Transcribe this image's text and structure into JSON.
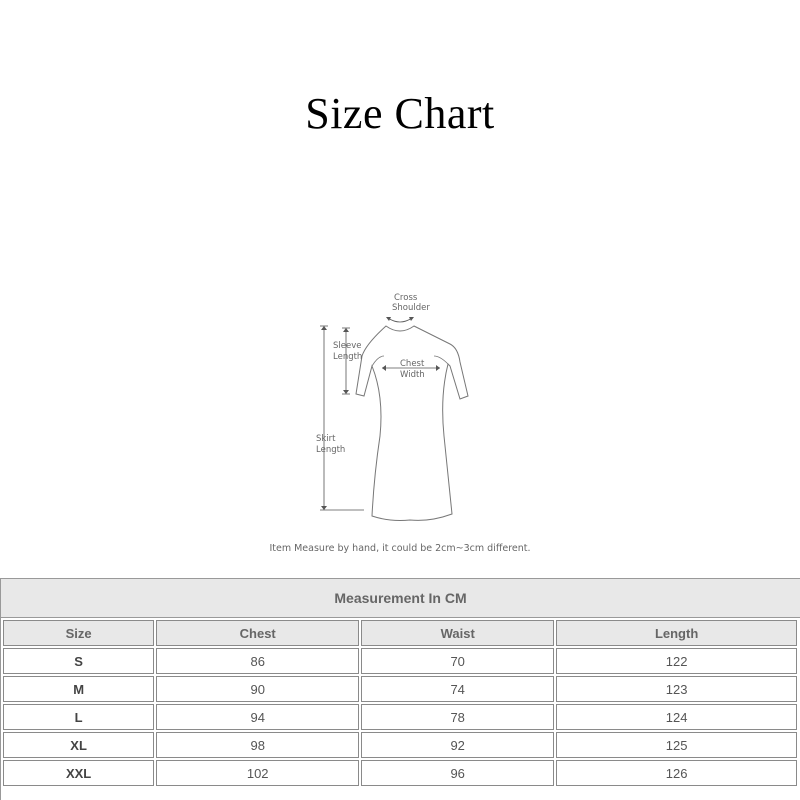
{
  "title": "Size Chart",
  "diagram": {
    "labels": {
      "cross_shoulder_1": "Cross",
      "cross_shoulder_2": "Shoulder",
      "sleeve_1": "Sleeve",
      "sleeve_2": "Length",
      "chest_1": "Chest",
      "chest_2": "Width",
      "skirt_1": "Skirt",
      "skirt_2": "Length"
    }
  },
  "note": "Item Measure by hand, it could be 2cm~3cm different.",
  "table": {
    "caption": "Measurement In CM",
    "headers": [
      "Size",
      "Chest",
      "Waist",
      "Length"
    ],
    "rows": [
      [
        "S",
        "86",
        "70",
        "122"
      ],
      [
        "M",
        "90",
        "74",
        "123"
      ],
      [
        "L",
        "94",
        "78",
        "124"
      ],
      [
        "XL",
        "98",
        "92",
        "125"
      ],
      [
        "XXL",
        "102",
        "96",
        "126"
      ]
    ]
  }
}
